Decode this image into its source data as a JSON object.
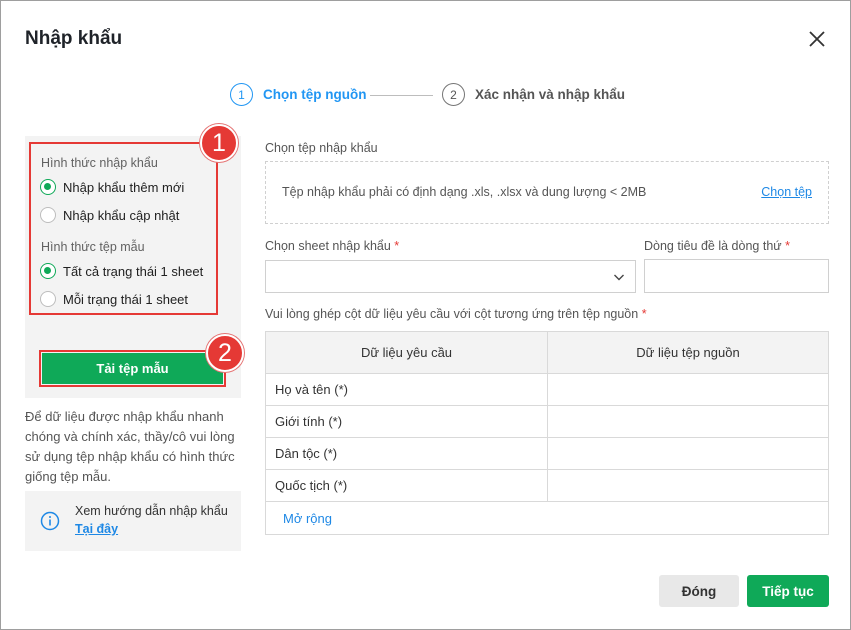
{
  "dialog": {
    "title": "Nhập khẩu"
  },
  "stepper": {
    "steps": [
      {
        "num": "1",
        "label": "Chọn tệp nguồn",
        "active": true
      },
      {
        "num": "2",
        "label": "Xác nhận và nhập khẩu",
        "active": false
      }
    ]
  },
  "left": {
    "import_type_label": "Hình thức nhập khẩu",
    "import_options": [
      {
        "label": "Nhập khẩu thêm mới",
        "selected": true
      },
      {
        "label": "Nhập khẩu cập nhật",
        "selected": false
      }
    ],
    "template_type_label": "Hình thức tệp mẫu",
    "template_options": [
      {
        "label": "Tất cả trạng thái 1 sheet",
        "selected": true
      },
      {
        "label": "Mỗi trạng thái 1 sheet",
        "selected": false
      }
    ],
    "badge1": "1",
    "badge2": "2",
    "download_button": "Tải tệp mẫu",
    "note": "Để dữ liệu được nhập khẩu nhanh chóng và chính xác, thầy/cô vui lòng sử dụng tệp nhập khẩu có hình thức giống tệp mẫu.",
    "help_text": "Xem hướng dẫn nhập khẩu",
    "help_link": "Tại đây"
  },
  "file": {
    "label": "Chọn tệp nhập khẩu",
    "hint": "Tệp nhập khẩu phải có định dạng .xls, .xlsx và dung lượng < 2MB",
    "pick_link": "Chọn tệp"
  },
  "sheet": {
    "label": "Chọn sheet nhập khẩu",
    "value": ""
  },
  "header_row": {
    "label": "Dòng tiêu đề là dòng thứ",
    "value": ""
  },
  "mapping": {
    "label": "Vui lòng ghép cột dữ liệu yêu cầu với cột tương ứng trên tệp nguồn",
    "columns": [
      "Dữ liệu yêu cầu",
      "Dữ liệu tệp nguồn"
    ],
    "rows": [
      {
        "required": "Họ và tên (*)",
        "source": ""
      },
      {
        "required": "Giới tính (*)",
        "source": ""
      },
      {
        "required": "Dân tộc (*)",
        "source": ""
      },
      {
        "required": "Quốc tịch (*)",
        "source": ""
      }
    ],
    "expand": "Mở rộng"
  },
  "footer": {
    "close": "Đóng",
    "next": "Tiếp tục"
  },
  "required_mark": "*",
  "colors": {
    "accent_green": "#0fa958",
    "accent_blue": "#2196f3",
    "link_blue": "#1e88e5",
    "highlight_red": "#e53935"
  },
  "icons": [
    "close-icon",
    "chevron-down-icon",
    "info-icon"
  ]
}
